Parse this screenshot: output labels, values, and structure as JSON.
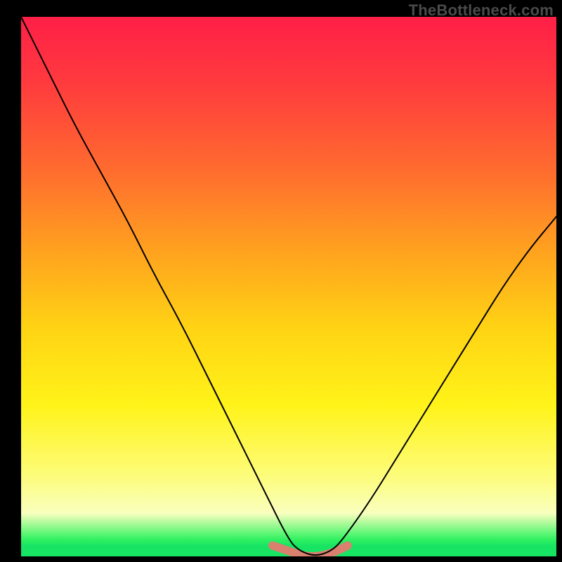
{
  "watermark": "TheBottleneck.com",
  "chart_data": {
    "type": "line",
    "title": "",
    "xlabel": "",
    "ylabel": "",
    "xlim": [
      0,
      100
    ],
    "ylim": [
      0,
      100
    ],
    "grid": false,
    "legend": false,
    "annotations": [],
    "series": [
      {
        "name": "main-curve",
        "x": [
          0,
          5,
          10,
          15,
          20,
          25,
          30,
          35,
          40,
          45,
          50,
          52,
          55,
          58,
          60,
          65,
          70,
          75,
          80,
          85,
          90,
          95,
          100
        ],
        "values": [
          100,
          90,
          80,
          71,
          62,
          52,
          43,
          33,
          23,
          13,
          3,
          1,
          0,
          1,
          3,
          10,
          18,
          26,
          34,
          42,
          50,
          57,
          63
        ]
      },
      {
        "name": "floor-highlight",
        "x": [
          47,
          50,
          53,
          56,
          59,
          61
        ],
        "values": [
          2,
          1,
          0,
          0,
          1,
          2
        ]
      }
    ],
    "background_gradient_stops": [
      {
        "pos": 0.0,
        "color": "#ff1f47"
      },
      {
        "pos": 0.28,
        "color": "#ff6a2f"
      },
      {
        "pos": 0.58,
        "color": "#ffd414"
      },
      {
        "pos": 0.85,
        "color": "#fdfc7a"
      },
      {
        "pos": 0.96,
        "color": "#2df060"
      },
      {
        "pos": 1.0,
        "color": "#18e463"
      }
    ]
  }
}
